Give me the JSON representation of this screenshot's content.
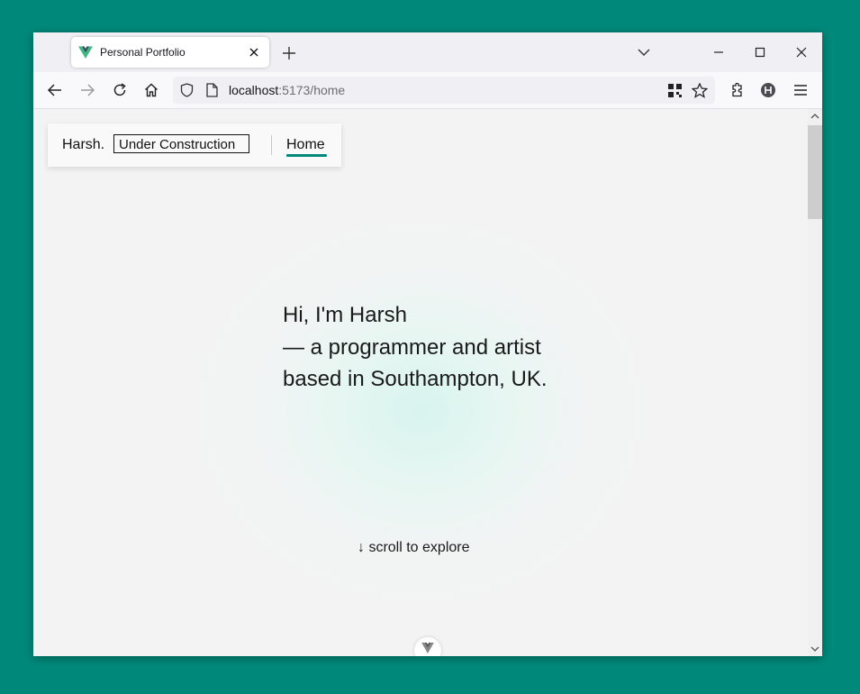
{
  "browser": {
    "tab": {
      "title": "Personal Portfolio",
      "favicon": "vue-logo-icon"
    },
    "url": {
      "host": "localhost",
      "port_path": ":5173/home"
    },
    "colors": {
      "desktop": "#00897a",
      "chrome": "#f0f0f4"
    }
  },
  "site": {
    "brand": "Harsh.",
    "badge": "Under Construction",
    "nav_home": "Home",
    "hero": {
      "line1": "Hi, I'm Harsh",
      "line2": "— a programmer and artist",
      "line3": "based in Southampton, UK."
    },
    "scroll_hint": "↓ scroll to explore",
    "accent": "#00897a"
  }
}
